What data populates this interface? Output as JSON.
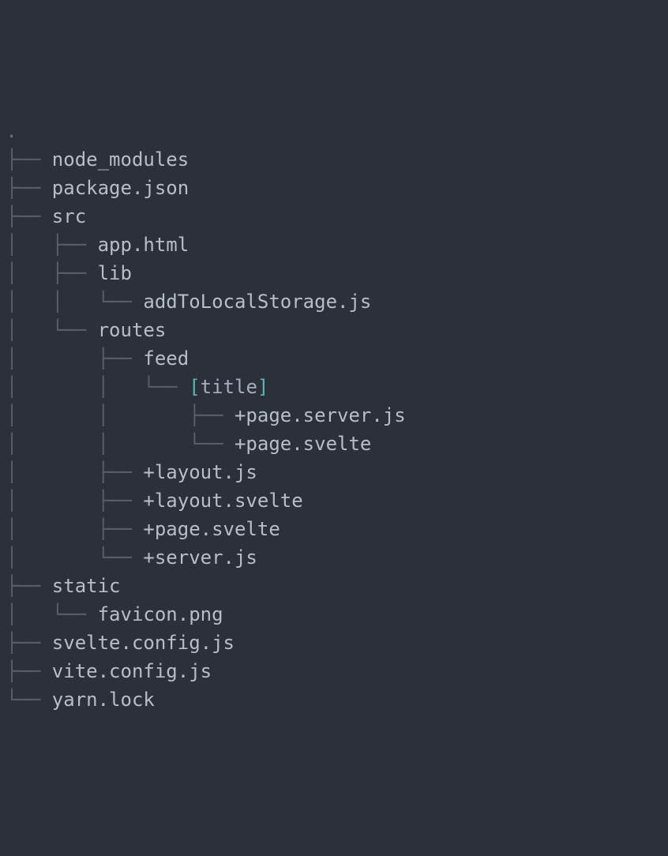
{
  "root_marker": ".",
  "lines": [
    {
      "prefix": "├── ",
      "text": "node_modules",
      "highlight": false
    },
    {
      "prefix": "├── ",
      "text": "package.json",
      "highlight": false
    },
    {
      "prefix": "├── ",
      "text": "src",
      "highlight": false
    },
    {
      "prefix": "│   ├── ",
      "text": "app.html",
      "highlight": false
    },
    {
      "prefix": "│   ├── ",
      "text": "lib",
      "highlight": false
    },
    {
      "prefix": "│   │   └── ",
      "text": "addToLocalStorage.js",
      "highlight": false
    },
    {
      "prefix": "│   └── ",
      "text": "routes",
      "highlight": false
    },
    {
      "prefix": "│       ├── ",
      "text": "feed",
      "highlight": false
    },
    {
      "prefix": "│       │   └── ",
      "text": "[title]",
      "highlight": true
    },
    {
      "prefix": "│       │       ├── ",
      "text": "+page.server.js",
      "highlight": false
    },
    {
      "prefix": "│       │       └── ",
      "text": "+page.svelte",
      "highlight": false
    },
    {
      "prefix": "│       ├── ",
      "text": "+layout.js",
      "highlight": false
    },
    {
      "prefix": "│       ├── ",
      "text": "+layout.svelte",
      "highlight": false
    },
    {
      "prefix": "│       ├── ",
      "text": "+page.svelte",
      "highlight": false
    },
    {
      "prefix": "│       └── ",
      "text": "+server.js",
      "highlight": false
    },
    {
      "prefix": "├── ",
      "text": "static",
      "highlight": false
    },
    {
      "prefix": "│   └── ",
      "text": "favicon.png",
      "highlight": false
    },
    {
      "prefix": "├── ",
      "text": "svelte.config.js",
      "highlight": false
    },
    {
      "prefix": "├── ",
      "text": "vite.config.js",
      "highlight": false
    },
    {
      "prefix": "└── ",
      "text": "yarn.lock",
      "highlight": false
    }
  ]
}
